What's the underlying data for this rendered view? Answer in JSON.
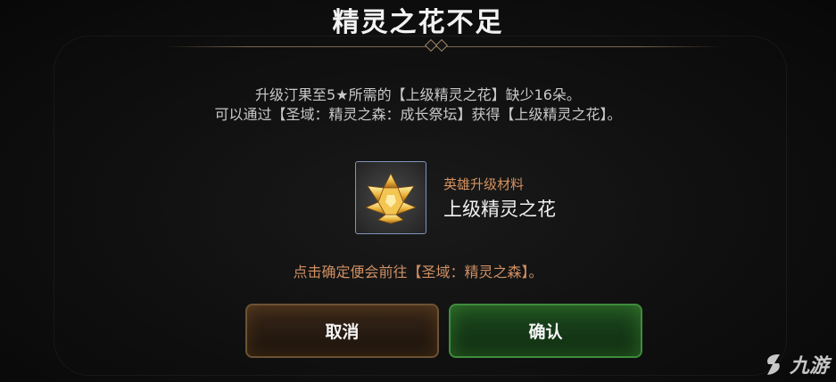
{
  "dialog": {
    "title": "精灵之花不足",
    "message_line1": "升级汀果至5★所需的【上级精灵之花】缺少16朵。",
    "message_line2": "可以通过【圣域：精灵之森：成长祭坛】获得【上级精灵之花】。",
    "item": {
      "category": "英雄升级材料",
      "name": "上级精灵之花",
      "icon": "golden-spirit-flower-icon"
    },
    "hint": "点击确定便会前往【圣域：精灵之森】。",
    "cancel_label": "取消",
    "confirm_label": "确认"
  },
  "watermark": {
    "text": "九游"
  },
  "colors": {
    "category": "#d5915f",
    "hint": "#cf8f62",
    "cancel_border": "#6d5234",
    "confirm_border": "#3f8c3c"
  }
}
